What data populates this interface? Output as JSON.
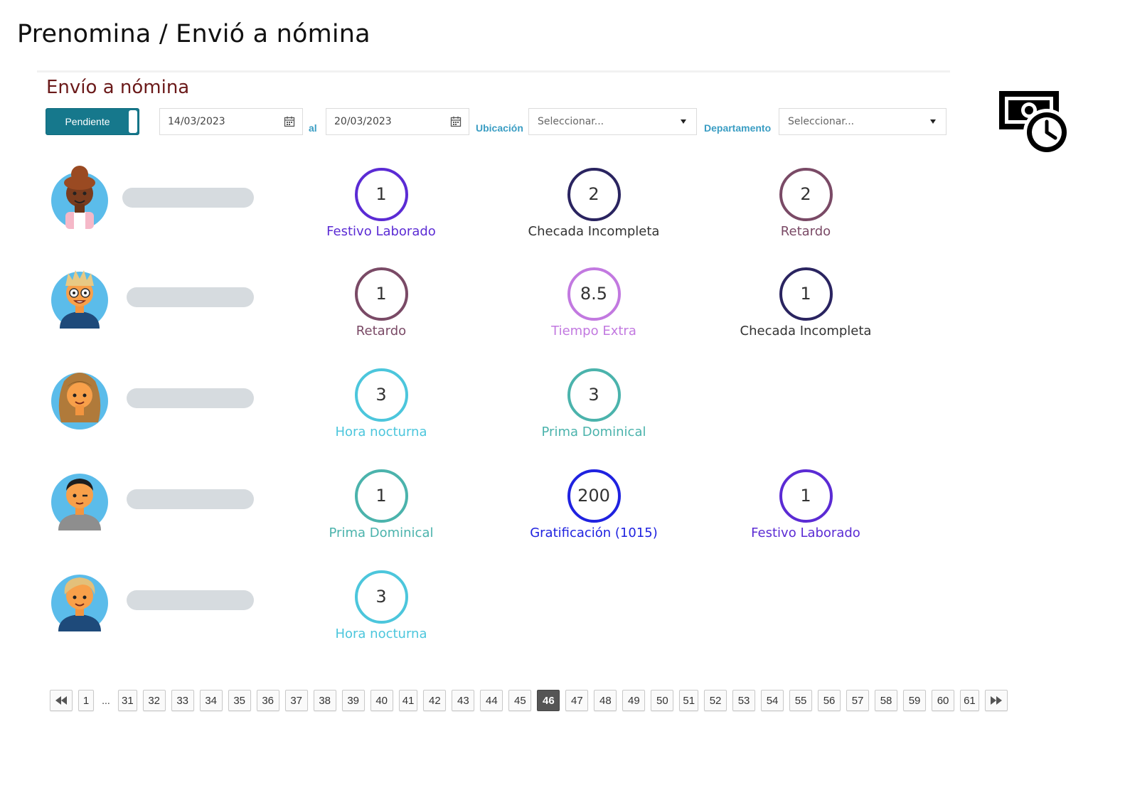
{
  "header": {
    "breadcrumb": "Prenomina / Envió a nómina"
  },
  "section": {
    "title": "Envío a nómina"
  },
  "filters": {
    "toggle_label": "Pendiente",
    "date_from": "14/03/2023",
    "date_separator": "al",
    "date_to": "20/03/2023",
    "location_label": "Ubicación",
    "location_value": "Seleccionar...",
    "department_label": "Departamento",
    "department_value": "Seleccionar..."
  },
  "icons": {
    "top_right": "money-clock-icon",
    "calendar": "calendar-icon",
    "dropdown": "caret-down-icon"
  },
  "colors": {
    "accent": "#16788c",
    "section_title": "#6b1a1a",
    "filter_label": "#3a9dc3",
    "festivo": "#5b2bd4",
    "checada": "#2a2460",
    "retardo": "#7a4a66",
    "tiempo_extra": "#c279e0",
    "hora_nocturna": "#4cc6dc",
    "prima": "#4bb3ac",
    "gratificacion": "#1f22e0"
  },
  "employees": [
    {
      "avatar": "avatar-woman-dark-curly",
      "metrics": [
        {
          "value": "1",
          "label": "Festivo Laborado",
          "color": "#5b2bd4"
        },
        {
          "value": "2",
          "label": "Checada Incompleta",
          "color": "#2a2460"
        },
        {
          "value": "2",
          "label": "Retardo",
          "color": "#7a4a66"
        }
      ]
    },
    {
      "avatar": "avatar-man-blond-glasses",
      "metrics": [
        {
          "value": "1",
          "label": "Retardo",
          "color": "#7a4a66"
        },
        {
          "value": "8.5",
          "label": "Tiempo Extra",
          "color": "#c279e0"
        },
        {
          "value": "1",
          "label": "Checada Incompleta",
          "color": "#2a2460"
        }
      ]
    },
    {
      "avatar": "avatar-woman-long-curly",
      "metrics": [
        {
          "value": "3",
          "label": "Hora nocturna",
          "color": "#4cc6dc"
        },
        {
          "value": "3",
          "label": "Prima Dominical",
          "color": "#4bb3ac"
        }
      ]
    },
    {
      "avatar": "avatar-man-short-hair",
      "metrics": [
        {
          "value": "1",
          "label": "Prima Dominical",
          "color": "#4bb3ac"
        },
        {
          "value": "200",
          "label": "Gratificación (1015)",
          "color": "#1f22e0"
        },
        {
          "value": "1",
          "label": "Festivo Laborado",
          "color": "#5b2bd4"
        }
      ]
    },
    {
      "avatar": "avatar-man-blond",
      "metrics": [
        {
          "value": "3",
          "label": "Hora nocturna",
          "color": "#4cc6dc"
        }
      ]
    }
  ],
  "pagination": {
    "first_icon": "first-page-icon",
    "last_icon": "last-page-icon",
    "pages": [
      "1",
      "...",
      "31",
      "32",
      "33",
      "34",
      "35",
      "36",
      "37",
      "38",
      "39",
      "40",
      "41",
      "42",
      "43",
      "44",
      "45",
      "46",
      "47",
      "48",
      "49",
      "50",
      "51",
      "52",
      "53",
      "54",
      "55",
      "56",
      "57",
      "58",
      "59",
      "60",
      "61"
    ],
    "current": "46"
  }
}
